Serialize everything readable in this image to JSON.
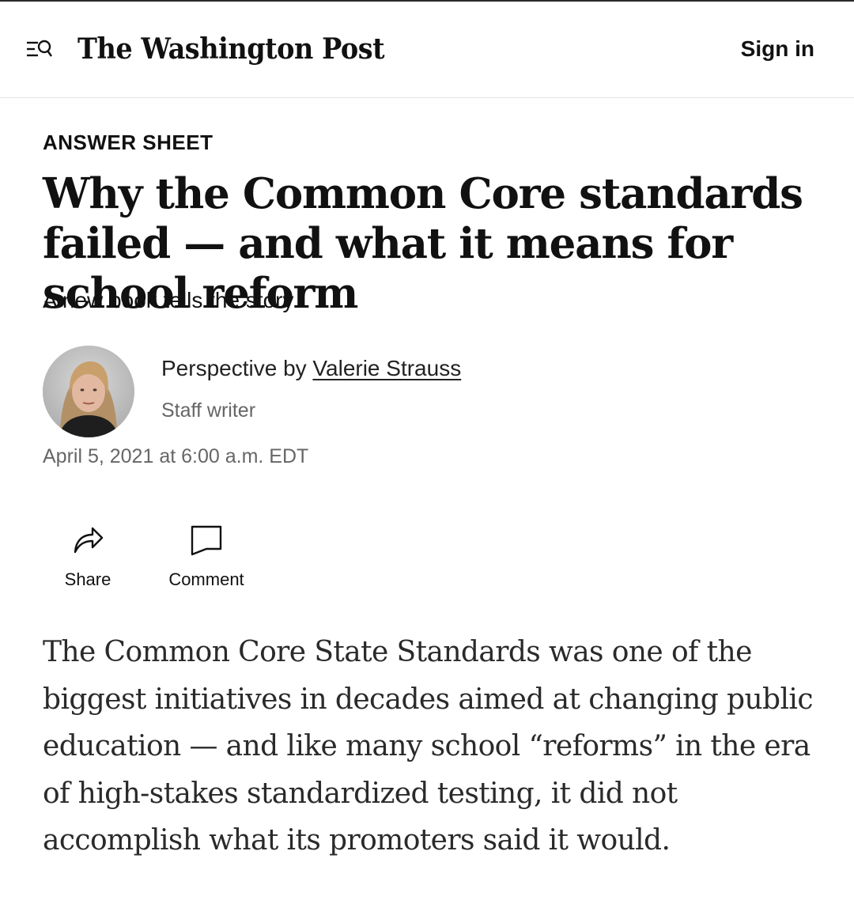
{
  "header": {
    "logo_text": "The Washington Post",
    "sign_in_label": "Sign in"
  },
  "article": {
    "kicker": "ANSWER SHEET",
    "headline": "Why the Common Core standards failed — and what it means for school reform",
    "subheadline": "A new book tells the story",
    "byline_prefix": "Perspective by ",
    "author": "Valerie Strauss",
    "author_role": "Staff writer",
    "date": "April 5, 2021 at 6:00 a.m. EDT",
    "actions": {
      "share_label": "Share",
      "comment_label": "Comment"
    },
    "body": "The Common Core State Standards was one of the biggest initiatives in decades aimed at changing public education — and like many school “reforms” in the era of high-stakes standardized testing, it did not accomplish what its promoters said it would."
  },
  "icons": {
    "menu": "menu-search-icon",
    "share": "share-arrow-icon",
    "comment": "comment-bubble-icon"
  }
}
